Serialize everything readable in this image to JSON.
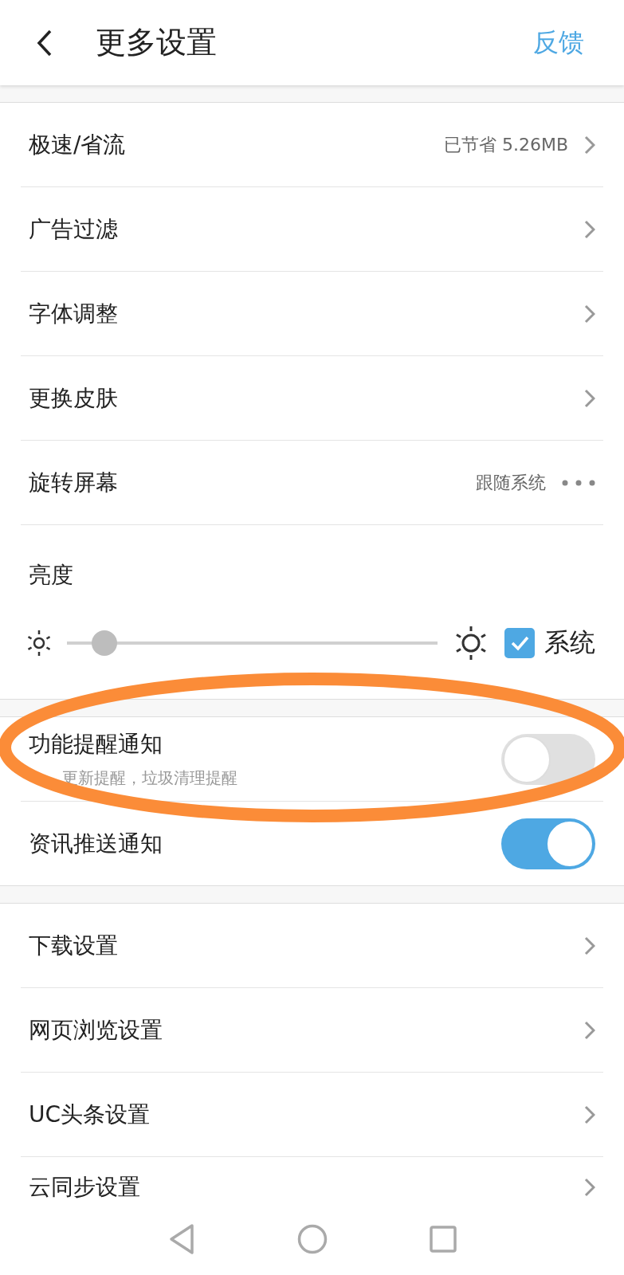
{
  "header": {
    "title": "更多设置",
    "action": "反馈"
  },
  "groups": [
    {
      "items": [
        {
          "kind": "link",
          "label": "极速/省流",
          "value": "已节省 5.26MB"
        },
        {
          "kind": "link",
          "label": "广告过滤"
        },
        {
          "kind": "link",
          "label": "字体调整"
        },
        {
          "kind": "link",
          "label": "更换皮肤"
        },
        {
          "kind": "menu",
          "label": "旋转屏幕",
          "value": "跟随系统"
        },
        {
          "kind": "brightness",
          "label": "亮度",
          "level": 0.1,
          "checkbox_label": "系统",
          "checked": true
        }
      ]
    },
    {
      "items": [
        {
          "kind": "toggle",
          "label": "功能提醒通知",
          "subtitle": "更新提醒，垃圾清理提醒",
          "on": false
        },
        {
          "kind": "toggle",
          "label": "资讯推送通知",
          "on": true
        }
      ]
    },
    {
      "items": [
        {
          "kind": "link",
          "label": "下载设置"
        },
        {
          "kind": "link",
          "label": "网页浏览设置"
        },
        {
          "kind": "link",
          "label": "UC头条设置"
        },
        {
          "kind": "link",
          "label": "云同步设置"
        }
      ]
    }
  ]
}
